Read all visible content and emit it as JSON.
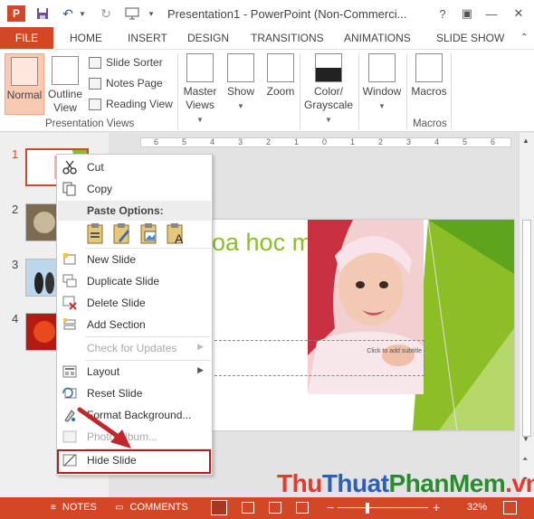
{
  "titlebar": {
    "app_title": "Presentation1 - PowerPoint (Non-Commerci...",
    "app_icon": "P",
    "quick_access": [
      "save-icon",
      "undo-icon",
      "redo-icon",
      "presenter-icon",
      "customize-icon"
    ],
    "window_buttons": {
      "help": "?",
      "ribbon_options": "▣",
      "minimize": "—",
      "restore": "☐",
      "close": "✕"
    }
  },
  "tabs": {
    "file": "FILE",
    "items": [
      "HOME",
      "INSERT",
      "DESIGN",
      "TRANSITIONS",
      "ANIMATIONS",
      "SLIDE SHOW"
    ],
    "collapse_arrow": "⌃"
  },
  "ribbon": {
    "presentation_views": {
      "normal": "Normal",
      "outline_view": [
        "Outline",
        "View"
      ],
      "slide_sorter": "Slide Sorter",
      "notes_page": "Notes Page",
      "reading_view": "Reading View",
      "group_label": "Presentation Views"
    },
    "master_views": [
      "Master",
      "Views"
    ],
    "show": "Show",
    "zoom": "Zoom",
    "color_grayscale": [
      "Color/",
      "Grayscale"
    ],
    "window": "Window",
    "macros": "Macros",
    "macros_group_label": "Macros"
  },
  "thumbnails": [
    {
      "number": "1"
    },
    {
      "number": "2"
    },
    {
      "number": "3"
    },
    {
      "number": "4"
    }
  ],
  "ruler": {
    "labels": [
      "6",
      "5",
      "4",
      "3",
      "2",
      "1",
      "0",
      "1",
      "2",
      "3",
      "4",
      "5",
      "6"
    ]
  },
  "slide": {
    "title": "oa hoc máy tính",
    "subtitle_placeholder": "Click to add subtitle"
  },
  "context_menu": {
    "cut": "Cut",
    "copy": "Copy",
    "paste_options_header": "Paste Options:",
    "new_slide": "New Slide",
    "duplicate_slide": "Duplicate Slide",
    "delete_slide": "Delete Slide",
    "add_section": "Add Section",
    "check_for_updates": "Check for Updates",
    "layout": "Layout",
    "reset_slide": "Reset Slide",
    "format_background": "Format Background...",
    "photo_album": "Photo Album...",
    "hide_slide": "Hide Slide",
    "submenu_arrow": "▶"
  },
  "statusbar": {
    "notes": "NOTES",
    "comments": "COMMENTS",
    "zoom_minus": "−",
    "zoom_plus": "+",
    "zoom_level": "32%",
    "zoom_fraction": 0.32
  },
  "watermark": {
    "part1": "Thu",
    "part2": "Thuat",
    "part3": "PhanMem",
    "part4": ".vn"
  },
  "colors": {
    "accent": "#d24726",
    "slide_title": "#8cbf26",
    "highlight_border": "#b01e22",
    "arrow": "#c0262c"
  }
}
